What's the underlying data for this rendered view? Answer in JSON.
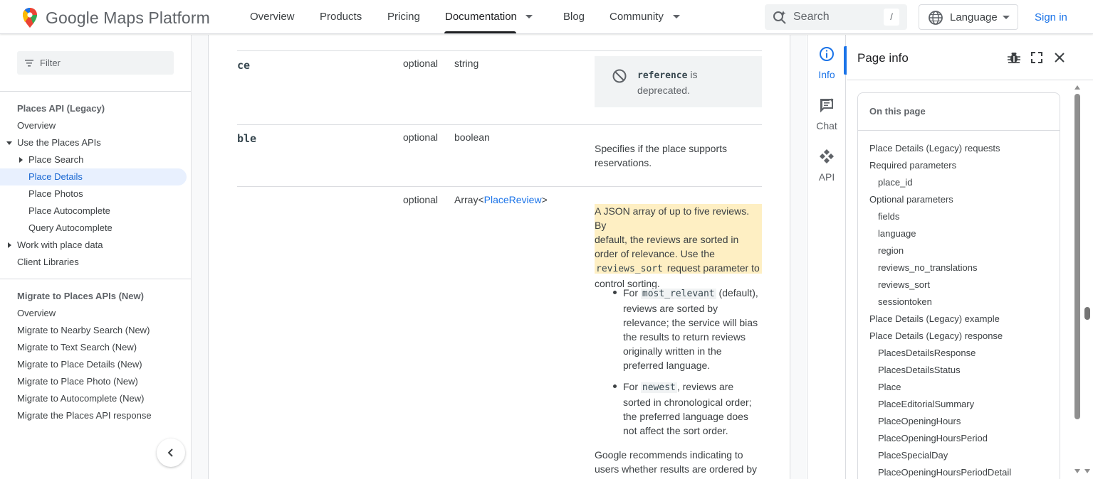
{
  "header": {
    "brand_word": "Google",
    "brand_rest": "Maps Platform",
    "nav": [
      {
        "label": "Overview"
      },
      {
        "label": "Products"
      },
      {
        "label": "Pricing"
      },
      {
        "label": "Documentation"
      },
      {
        "label": "Blog"
      },
      {
        "label": "Community"
      }
    ],
    "search_placeholder": "Search",
    "search_shortcut": "/",
    "language_label": "Language",
    "signin_label": "Sign in"
  },
  "sidebar": {
    "filter_placeholder": "Filter",
    "items": [
      {
        "label": "Places API (Legacy)"
      },
      {
        "label": "Overview"
      },
      {
        "label": "Use the Places APIs"
      },
      {
        "label": "Place Search"
      },
      {
        "label": "Place Details"
      },
      {
        "label": "Place Photos"
      },
      {
        "label": "Place Autocomplete"
      },
      {
        "label": "Query Autocomplete"
      },
      {
        "label": "Work with place data"
      },
      {
        "label": "Client Libraries"
      },
      {
        "label": "Migrate to Places APIs (New)"
      },
      {
        "label": "Overview"
      },
      {
        "label": "Migrate to Nearby Search (New)"
      },
      {
        "label": "Migrate to Text Search (New)"
      },
      {
        "label": "Migrate to Place Details (New)"
      },
      {
        "label": "Migrate to Place Photo (New)"
      },
      {
        "label": "Migrate to Autocomplete (New)"
      },
      {
        "label": "Migrate the Places API response"
      }
    ]
  },
  "content": {
    "rows": [
      {
        "name_fragment": "ce",
        "required": "optional",
        "type": "string"
      },
      {
        "name_fragment": "ble",
        "required": "optional",
        "type": "boolean"
      },
      {
        "required": "optional",
        "type_prefix": "Array<",
        "type_link": "PlaceReview",
        "type_suffix": ">"
      }
    ],
    "deprecated_code": "reference",
    "deprecated_is": "is",
    "deprecated_word": "deprecated.",
    "reservable_desc_1": "Specifies if the place supports",
    "reservable_desc_2": "reservations.",
    "reviews_hl_1": "A JSON array of up to five reviews. By",
    "reviews_hl_2": "default, the reviews are sorted in",
    "reviews_hl_3": "order of relevance. Use the",
    "reviews_hl_code": "reviews_sort",
    "reviews_hl_4": "request parameter to",
    "reviews_hl_5": "control sorting.",
    "bullet1_for": "For",
    "bullet1_code": "most_relevant",
    "bullet1_rest": "(default), reviews are sorted by relevance; the service will bias the results to return reviews originally written in the preferred language.",
    "bullet2_for": "For",
    "bullet2_code": "newest",
    "bullet2_rest": ", reviews are sorted in chronological order; the preferred language does not affect the sort order.",
    "recommend_1": "Google recommends indicating to",
    "recommend_2": "users whether results are ordered by"
  },
  "rail": {
    "info": "Info",
    "chat": "Chat",
    "api": "API"
  },
  "page_info": {
    "title": "Page info",
    "toc_title": "On this page",
    "toc": [
      {
        "label": "Place Details (Legacy) requests",
        "level": 0
      },
      {
        "label": "Required parameters",
        "level": 0
      },
      {
        "label": "place_id",
        "level": 1
      },
      {
        "label": "Optional parameters",
        "level": 0
      },
      {
        "label": "fields",
        "level": 1
      },
      {
        "label": "language",
        "level": 1
      },
      {
        "label": "region",
        "level": 1
      },
      {
        "label": "reviews_no_translations",
        "level": 1
      },
      {
        "label": "reviews_sort",
        "level": 1
      },
      {
        "label": "sessiontoken",
        "level": 1
      },
      {
        "label": "Place Details (Legacy) example",
        "level": 0
      },
      {
        "label": "Place Details (Legacy) response",
        "level": 0
      },
      {
        "label": "PlacesDetailsResponse",
        "level": 1
      },
      {
        "label": "PlacesDetailsStatus",
        "level": 1
      },
      {
        "label": "Place",
        "level": 1
      },
      {
        "label": "PlaceEditorialSummary",
        "level": 1
      },
      {
        "label": "PlaceOpeningHours",
        "level": 1
      },
      {
        "label": "PlaceOpeningHoursPeriod",
        "level": 1
      },
      {
        "label": "PlaceSpecialDay",
        "level": 1
      },
      {
        "label": "PlaceOpeningHoursPeriodDetail",
        "level": 1
      }
    ]
  },
  "colors": {
    "accent": "#1a73e8",
    "highlight": "#feefc3",
    "active_nav_bg": "#e8f0fe"
  }
}
